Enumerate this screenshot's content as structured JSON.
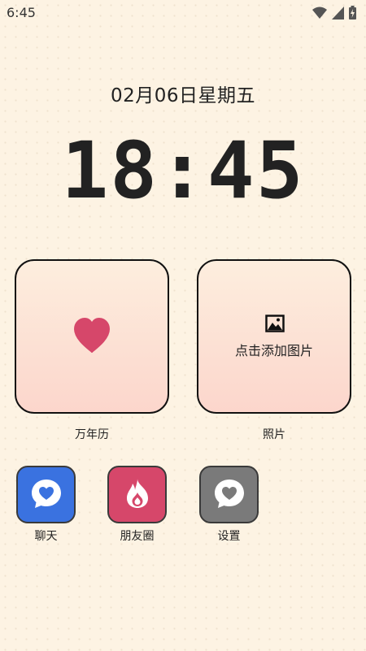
{
  "status_bar": {
    "time": "6:45",
    "icons": [
      "wifi-icon",
      "cellular-signal-icon",
      "battery-charging-icon"
    ]
  },
  "lock_screen": {
    "date": "02月06日星期五",
    "time": "18:45"
  },
  "widgets": {
    "calendar": {
      "label": "万年历",
      "icon": "heart-icon",
      "accent": "#d6476a"
    },
    "photo": {
      "label": "照片",
      "placeholder": "点击添加图片",
      "icon": "image-icon"
    }
  },
  "apps": [
    {
      "label": "聊天",
      "icon": "chat-heart-icon",
      "color": "#3a72e0"
    },
    {
      "label": "朋友圈",
      "icon": "flame-icon",
      "color": "#d6476a"
    },
    {
      "label": "设置",
      "icon": "chat-heart-icon",
      "color": "#7a7a7a"
    }
  ],
  "colors": {
    "background": "#fdf3e3",
    "widget_gradient_top": "#fdeede",
    "widget_gradient_bottom": "#fcd6cc"
  }
}
